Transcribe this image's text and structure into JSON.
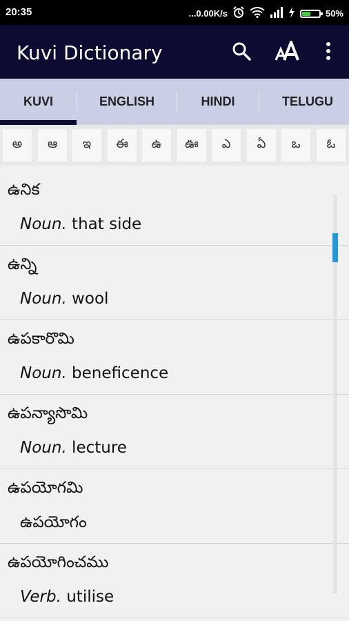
{
  "status_bar": {
    "time": "20:35",
    "network_speed": "...0.00K/s",
    "battery_percent": "50%",
    "battery_level": 0.5,
    "battery_color": "#3fd13f",
    "icons": [
      "alarm-icon",
      "wifi-icon",
      "signal-icon",
      "charging-icon",
      "battery-icon"
    ]
  },
  "app_bar": {
    "title": "Kuvi Dictionary",
    "background": "#0c0c33",
    "actions": [
      "search-icon",
      "font-size-icon",
      "overflow-menu-icon"
    ]
  },
  "tabs": {
    "items": [
      {
        "label": "KUVI",
        "selected": true
      },
      {
        "label": "ENGLISH",
        "selected": false
      },
      {
        "label": "HINDI",
        "selected": false
      },
      {
        "label": "TELUGU",
        "selected": false
      }
    ],
    "background": "#cacfe5",
    "indicator_color": "#0c0c33"
  },
  "alphabet": [
    "అ",
    "ఆ",
    "ఇ",
    "ఈ",
    "ఉ",
    "ఊ",
    "ఎ",
    "ఏ",
    "ఒ",
    "ఓ"
  ],
  "entries": [
    {
      "word": "ఉనిక",
      "pos": "Noun.",
      "meaning": " that side"
    },
    {
      "word": "ఉన్ని",
      "pos": "Noun.",
      "meaning": " wool"
    },
    {
      "word": "ఉపకారొమి",
      "pos": "Noun.",
      "meaning": " beneficence"
    },
    {
      "word": "ఉపన్యాసొమి",
      "pos": "Noun.",
      "meaning": " lecture"
    },
    {
      "word": "ఉపయోగమి",
      "pos": "",
      "meaning": "ఉపయోగం"
    },
    {
      "word": "ఉపయోగించము",
      "pos": "Verb.",
      "meaning": " utilise"
    }
  ],
  "scrollbar": {
    "color": "#1f9ad6"
  }
}
